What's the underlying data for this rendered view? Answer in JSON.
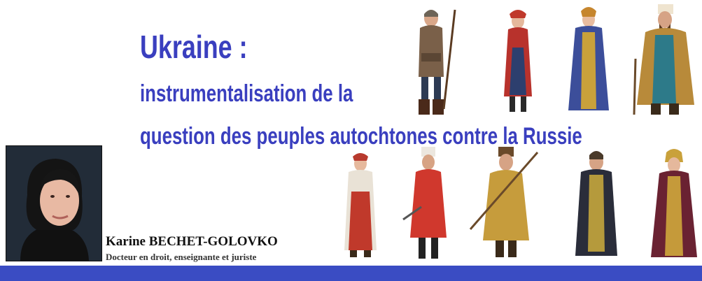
{
  "banner": {
    "title": "Ukraine :",
    "subtitle_line1": "instrumentalisation de la",
    "subtitle_line2": "question des peuples autochtones contre la Russie"
  },
  "author": {
    "name": "Karine BECHET-GOLOVKO",
    "description": "Docteur en droit, enseignante et juriste"
  },
  "colors": {
    "title": "#3a3fbf",
    "bottom_bar": "#3a4cc3"
  }
}
